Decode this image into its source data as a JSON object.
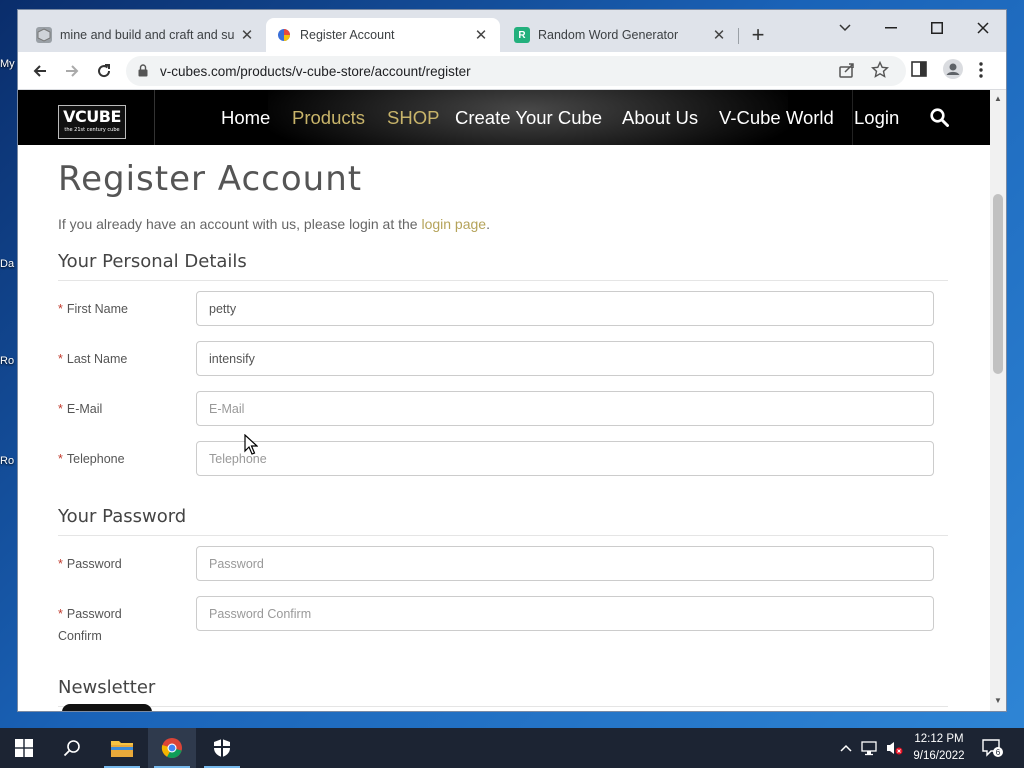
{
  "desktop": {
    "icons": [
      "My",
      "Da",
      "Ro",
      "Ro"
    ]
  },
  "browser": {
    "tabs": [
      {
        "title": "mine and build and craft and su",
        "icon": "cube-favicon-gray",
        "active": false
      },
      {
        "title": "Register Account",
        "icon": "vcube-favicon",
        "active": true
      },
      {
        "title": "Random Word Generator",
        "icon": "r-favicon",
        "active": false
      }
    ],
    "url": "v-cubes.com/products/v-cube-store/account/register"
  },
  "site": {
    "logo_text": "VCUBE",
    "logo_tagline": "the 21st century cube",
    "nav": [
      "Home",
      "Products",
      "SHOP",
      "Create Your Cube",
      "About Us",
      "V-Cube World",
      "Login"
    ]
  },
  "page": {
    "title": "Register Account",
    "intro_text": "If you already have an account with us, please login at the ",
    "intro_link": "login page",
    "intro_end": ".",
    "personal_section": "Your Personal Details",
    "password_section": "Your Password",
    "newsletter_section": "Newsletter",
    "required_mark": "*",
    "fields": {
      "first_name": {
        "label": "First Name",
        "value": "petty"
      },
      "last_name": {
        "label": "Last Name",
        "value": "intensify"
      },
      "email": {
        "label": "E-Mail",
        "placeholder": "E-Mail"
      },
      "telephone": {
        "label": "Telephone",
        "placeholder": "Telephone"
      },
      "password": {
        "label": "Password",
        "placeholder": "Password"
      },
      "confirm": {
        "label_line1": "Password",
        "label_line2": "Confirm",
        "placeholder": "Password Confirm"
      }
    }
  },
  "taskbar": {
    "time": "12:12 PM",
    "date": "9/16/2022",
    "notifications": "6"
  },
  "colors": {
    "accent_gold": "#c8b46a",
    "required_red": "#c0392b",
    "taskbar": "#1c2433"
  }
}
